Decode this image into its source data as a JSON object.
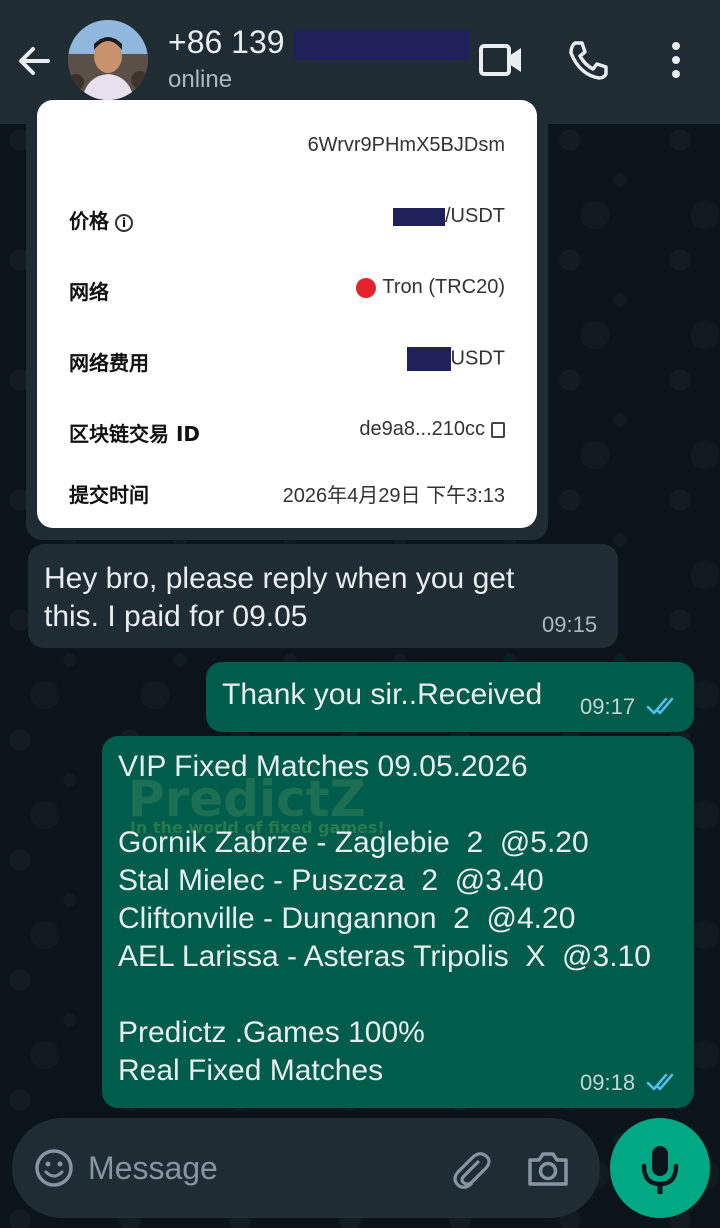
{
  "header": {
    "contact_name": "+86 139",
    "status": "online"
  },
  "receipt": {
    "address_partial": "6Wrvr9PHmX5BJDsm",
    "rows": [
      {
        "label": "价格",
        "value": "/USDT"
      },
      {
        "label": "网络",
        "value": "Tron (TRC20)"
      },
      {
        "label": "网络费用",
        "value": "USDT"
      },
      {
        "label": "区块链交易 ID",
        "value": "de9a8...210cc"
      },
      {
        "label": "提交时间",
        "value": "2026年4月29日 下午3:13"
      }
    ]
  },
  "messages": [
    {
      "direction": "incoming",
      "text": "Hey bro, please reply when you get\nthis. I paid for 09.05",
      "time": "09:15"
    },
    {
      "direction": "outgoing",
      "text": "Thank you sir..Received",
      "time": "09:17",
      "status": "read"
    },
    {
      "direction": "outgoing",
      "text": "VIP Fixed Matches 09.05.2026\n\nGornik Zabrze - Zaglebie  2  @5.20\nStal Mielec - Puszcza  2  @3.40\nCliftonville - Dungannon  2  @4.20\nAEL Larissa - Asteras Tripolis  X  @3.10\n\nPredictz .Games 100%\nReal Fixed Matches",
      "time": "09:18",
      "status": "read"
    }
  ],
  "watermark": {
    "logo_text": "PredictZ",
    "tagline": "In the world of fixed games!"
  },
  "composer": {
    "placeholder": "Message"
  },
  "colors": {
    "header_bg": "#1f2c33",
    "chat_bg": "#0b141a",
    "incoming_bubble": "#202c33",
    "outgoing_bubble": "#005c4b",
    "read_ticks": "#53bdeb",
    "mic_button": "#00a884"
  },
  "icons": [
    "back-arrow-icon",
    "video-call-icon",
    "phone-icon",
    "more-vert-icon",
    "emoji-icon",
    "attach-icon",
    "camera-icon",
    "mic-icon",
    "copy-icon",
    "info-icon",
    "tron-icon",
    "read-ticks-icon"
  ]
}
